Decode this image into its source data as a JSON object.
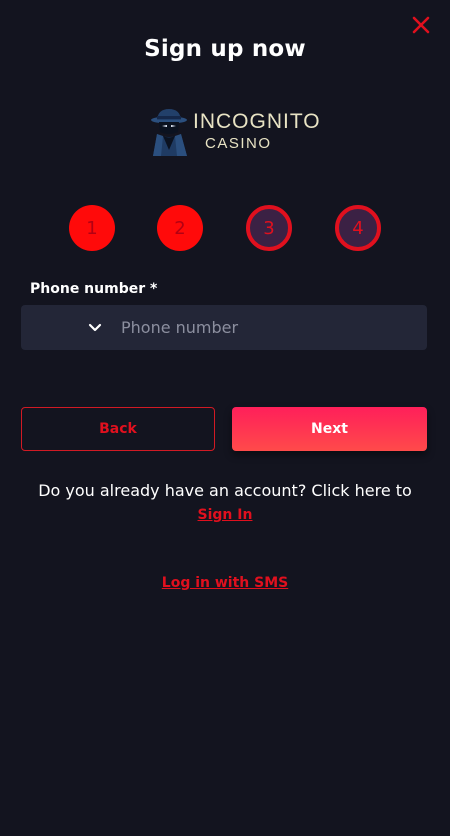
{
  "header": {
    "title": "Sign up now",
    "close_icon": "close-icon"
  },
  "logo": {
    "line1": "INCOGNITO",
    "line2": "CASINO",
    "icon": "spy-mascot-icon"
  },
  "steps": [
    {
      "label": "1",
      "state": "active"
    },
    {
      "label": "2",
      "state": "active"
    },
    {
      "label": "3",
      "state": "inactive"
    },
    {
      "label": "4",
      "state": "inactive"
    }
  ],
  "form": {
    "phone_label": "Phone number *",
    "phone_placeholder": "Phone number",
    "phone_value": "",
    "country_dropdown_icon": "chevron-down-icon"
  },
  "buttons": {
    "back_label": "Back",
    "next_label": "Next"
  },
  "footer": {
    "account_text": "Do you already have an account? Click here to",
    "signin_label": "Sign In",
    "sms_label": "Log in with SMS"
  },
  "colors": {
    "background": "#13141f",
    "accent_red": "#e0101e",
    "step_active": "#ff0a0a",
    "step_inactive_fill": "#3b2144",
    "field_bg": "#232637",
    "next_gradient_start": "#ff1f5a",
    "next_gradient_end": "#ff4a4a"
  }
}
